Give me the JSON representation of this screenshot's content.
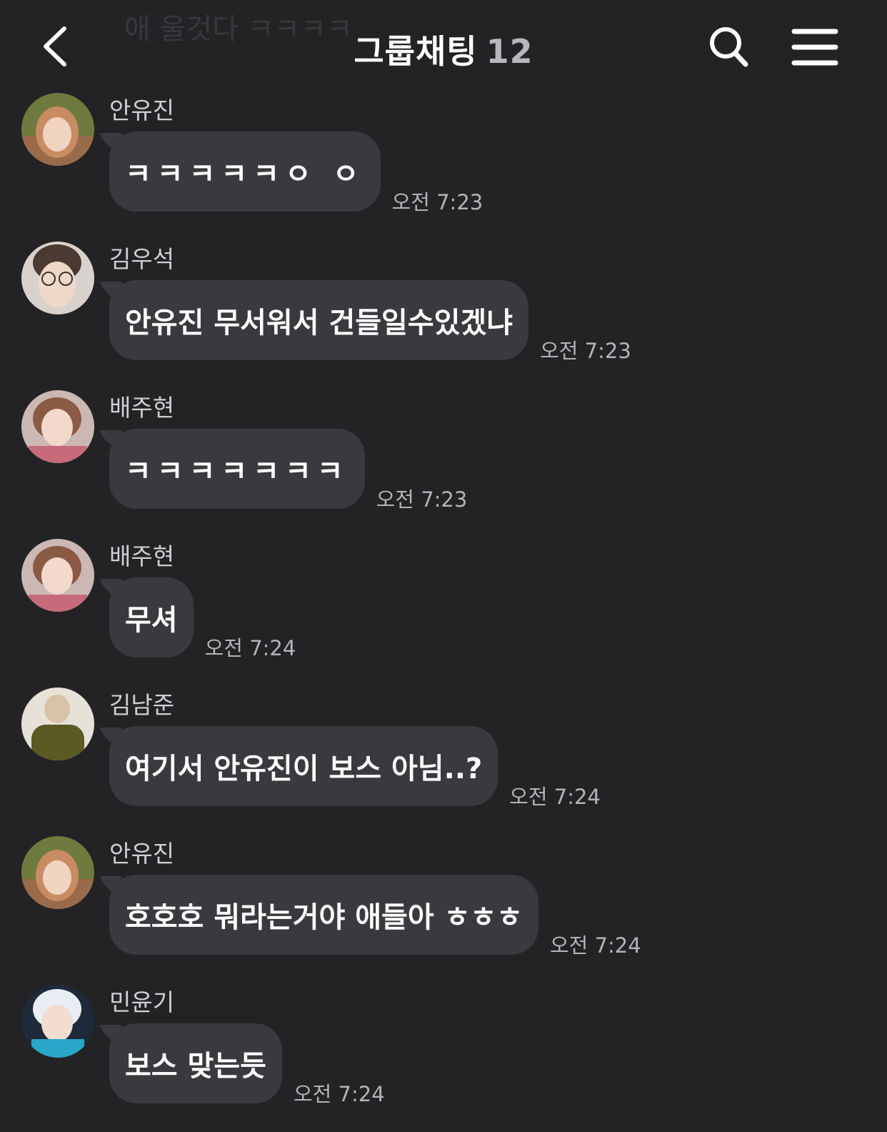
{
  "ghost_text": "애 울것다 ㅋㅋㅋㅋ",
  "header": {
    "title": "그룹채팅",
    "member_count": "12",
    "back_icon": "chevron-left-icon",
    "search_icon": "search-icon",
    "menu_icon": "hamburger-menu-icon"
  },
  "colors": {
    "background": "#232326",
    "bubble": "#3a3a3e",
    "text": "#ffffff",
    "secondary_text": "#b4b4b8"
  },
  "messages": [
    {
      "sender": "안유진",
      "text": "ㅋㅋㅋㅋㅋㅇ ㅇ",
      "time": "오전 7:23"
    },
    {
      "sender": "김우석",
      "text": "안유진 무서워서 건들일수있겠냐",
      "time": "오전 7:23"
    },
    {
      "sender": "배주현",
      "text": "ㅋㅋㅋㅋㅋㅋㅋ",
      "time": "오전 7:23"
    },
    {
      "sender": "배주현",
      "text": "무셔",
      "time": "오전 7:24"
    },
    {
      "sender": "김남준",
      "text": "여기서 안유진이 보스 아님..?",
      "time": "오전 7:24"
    },
    {
      "sender": "안유진",
      "text": "호호호 뭐라는거야 애들아 ㅎㅎㅎ",
      "time": "오전 7:24"
    },
    {
      "sender": "민윤기",
      "text": "보스 맞는듯",
      "time": "오전 7:24"
    }
  ]
}
